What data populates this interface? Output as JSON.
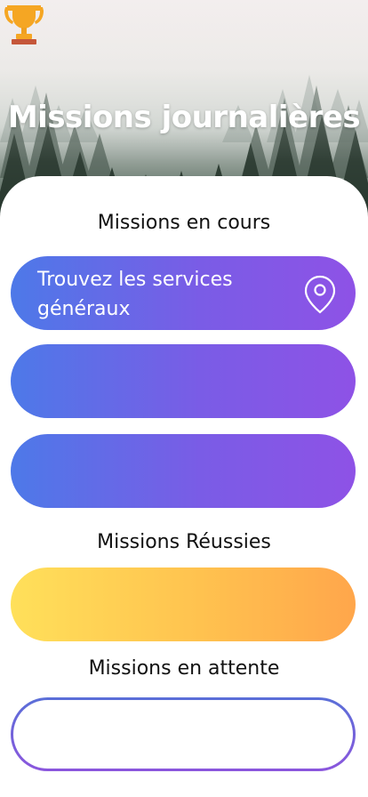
{
  "header": {
    "title": "Missions journalières",
    "icon": "trophy-icon"
  },
  "sections": {
    "in_progress": {
      "title": "Missions en cours",
      "missions": [
        {
          "label": "Trouvez les services généraux",
          "icon": "map-pin-icon"
        },
        {
          "label": ""
        },
        {
          "label": ""
        }
      ]
    },
    "succeeded": {
      "title": "Missions Réussies",
      "missions": [
        {
          "label": ""
        }
      ]
    },
    "pending": {
      "title": "Missions en attente",
      "missions": [
        {
          "label": ""
        }
      ]
    }
  },
  "colors": {
    "purple_start": "#4d79e8",
    "purple_end": "#8e52e6",
    "orange_start": "#ffe05a",
    "orange_end": "#ffa64b",
    "trophy": "#f5a623"
  }
}
